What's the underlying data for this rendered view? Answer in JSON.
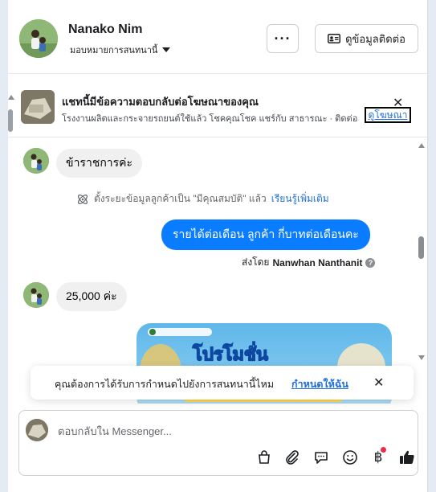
{
  "header": {
    "contact_name": "Nanako Nim",
    "assign_label": "มอบหมายการสนทนานี้",
    "more_label": "···",
    "contact_info_label": "ดูข้อมูลติดต่อ"
  },
  "ad_banner": {
    "title": "แชทนี้มีข้อความตอบกลับต่อโฆษณาของคุณ",
    "subtitle": "โรงงานผลิตและกระจายรถยนต์ใช้แล้ว โชคคุณโชค แชร์กับ สาธารณะ · ติดต่อ",
    "link_label": "ดูโฆษณา"
  },
  "messages": [
    {
      "direction": "in",
      "text": "ข้าราชการค่ะ"
    },
    {
      "direction": "system",
      "text": "ตั้งระยะข้อมูลลูกค้าเป็น \"มีคุณสมบัติ\" แล้ว",
      "link": "เรียนรู้เพิ่มเติม"
    },
    {
      "direction": "out",
      "text": "รายได้ต่อเดือน  ลูกค้า   กี่บาทต่อเดือนคะ",
      "sent_by_prefix": "ส่งโดย",
      "sent_by_name": "Nanwhan Nanthanit"
    },
    {
      "direction": "in",
      "text": "25,000 ค่ะ"
    },
    {
      "direction": "in",
      "type": "image",
      "promo_text": "โปรโมชั่น"
    }
  ],
  "toast": {
    "text": "คุณต้องการได้รับการกำหนดไปยังการสนทนานี้ไหม",
    "link": "กำหนดให้ฉัน"
  },
  "composer": {
    "placeholder": "ตอบกลับใน Messenger..."
  },
  "colors": {
    "accent": "#0a7cff",
    "link": "#216fdb",
    "bubble_in": "#f0f0f0",
    "notification_dot": "#f02849"
  }
}
